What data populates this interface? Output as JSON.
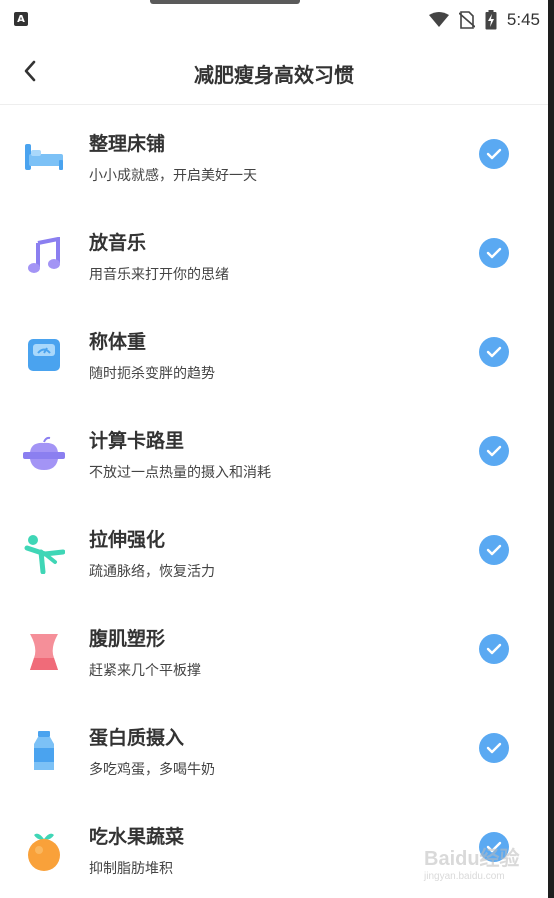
{
  "status_bar": {
    "left_icon": "A",
    "time": "5:45",
    "icons": [
      "wifi-icon",
      "no-sim-icon",
      "battery-charging-icon"
    ]
  },
  "header": {
    "title": "减肥瘦身高效习惯",
    "back_icon": "chevron-left-icon"
  },
  "habits": [
    {
      "title": "整理床铺",
      "desc": "小小成就感，开启美好一天",
      "icon": "bed-icon",
      "checked": true
    },
    {
      "title": "放音乐",
      "desc": "用音乐来打开你的思绪",
      "icon": "music-note-icon",
      "checked": true
    },
    {
      "title": "称体重",
      "desc": "随时扼杀变胖的趋势",
      "icon": "scale-icon",
      "checked": true
    },
    {
      "title": "计算卡路里",
      "desc": "不放过一点热量的摄入和消耗",
      "icon": "apple-calorie-icon",
      "checked": true
    },
    {
      "title": "拉伸强化",
      "desc": "疏通脉络，恢复活力",
      "icon": "stretch-figure-icon",
      "checked": true
    },
    {
      "title": "腹肌塑形",
      "desc": "赶紧来几个平板撑",
      "icon": "waist-icon",
      "checked": true
    },
    {
      "title": "蛋白质摄入",
      "desc": "多吃鸡蛋，多喝牛奶",
      "icon": "milk-bottle-icon",
      "checked": true
    },
    {
      "title": "吃水果蔬菜",
      "desc": "抑制脂肪堆积",
      "icon": "orange-icon",
      "checked": true
    }
  ],
  "colors": {
    "check": "#5aa9f2",
    "title_text": "#333333"
  },
  "watermark": {
    "logo": "Baidu经验",
    "url": "jingyan.baidu.com"
  }
}
